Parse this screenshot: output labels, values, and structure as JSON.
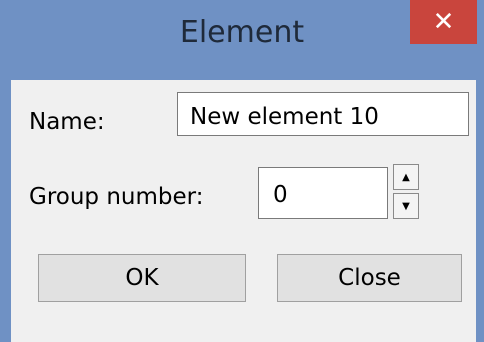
{
  "window": {
    "title": "Element",
    "close_glyph": "✕"
  },
  "form": {
    "name_label": "Name:",
    "name_value": "New element 10",
    "group_label": "Group number:",
    "group_value": "0"
  },
  "spinner": {
    "up_glyph": "▲",
    "down_glyph": "▼"
  },
  "buttons": {
    "ok_label": "OK",
    "close_label": "Close"
  },
  "colors": {
    "titlebar": "#6f91c4",
    "close_button": "#c9453d",
    "client_background": "#f0f0f0"
  }
}
